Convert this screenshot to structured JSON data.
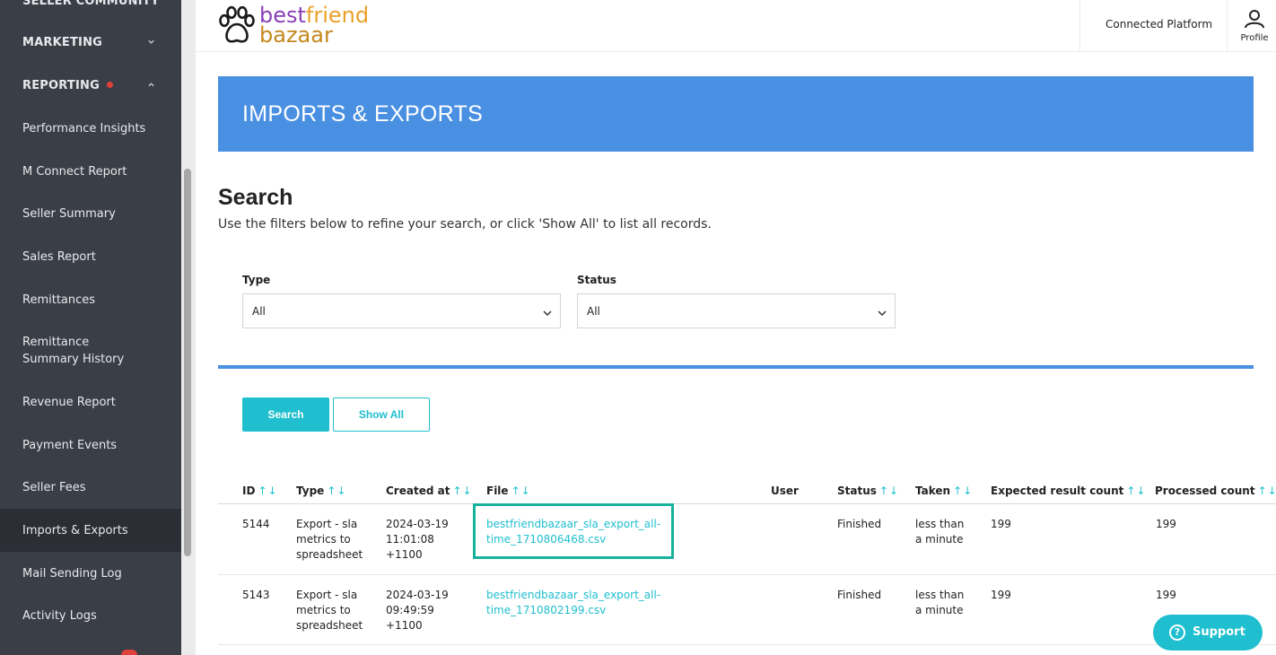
{
  "sidebar": {
    "sections": [
      {
        "label": "SELLER COMMUNITY"
      },
      {
        "label": "MARKETING"
      },
      {
        "label": "REPORTING"
      }
    ],
    "items": [
      {
        "label": "Performance Insights"
      },
      {
        "label": "M Connect Report"
      },
      {
        "label": "Seller Summary"
      },
      {
        "label": "Sales Report"
      },
      {
        "label": "Remittances"
      },
      {
        "label": "Remittance Summary History"
      },
      {
        "label": "Revenue Report"
      },
      {
        "label": "Payment Events"
      },
      {
        "label": "Seller Fees"
      },
      {
        "label": "Imports & Exports"
      },
      {
        "label": "Mail Sending Log"
      },
      {
        "label": "Activity Logs"
      }
    ],
    "active_item": "Imports & Exports"
  },
  "header": {
    "logo_line1_a": "best",
    "logo_line1_b": "friend",
    "logo_line2": "bazaar",
    "connected_platform": "Connected Platform",
    "profile_label": "Profile"
  },
  "banner": {
    "title": "IMPORTS & EXPORTS"
  },
  "search": {
    "title": "Search",
    "description": "Use the filters below to refine your search, or click 'Show All' to list all records.",
    "type_label": "Type",
    "type_value": "All",
    "status_label": "Status",
    "status_value": "All",
    "search_button": "Search",
    "show_all_button": "Show All"
  },
  "table": {
    "columns": [
      "ID",
      "Type",
      "Created at",
      "File",
      "User",
      "Status",
      "Taken",
      "Expected result count",
      "Processed count"
    ],
    "sort_arrows": "↑↓",
    "rows": [
      {
        "id": "5144",
        "type": [
          "Export - sla",
          "metrics to",
          "spreadsheet"
        ],
        "created": [
          "2024-03-19",
          "11:01:08",
          "+1100"
        ],
        "file": [
          "bestfriendbazaar_sla_export_all-",
          "time_1710806468.csv"
        ],
        "user": "",
        "status": "Finished",
        "taken": [
          "less than",
          "a minute"
        ],
        "expected": "199",
        "processed": "199"
      },
      {
        "id": "5143",
        "type": [
          "Export - sla",
          "metrics to",
          "spreadsheet"
        ],
        "created": [
          "2024-03-19",
          "09:49:59",
          "+1100"
        ],
        "file": [
          "bestfriendbazaar_sla_export_all-",
          "time_1710802199.csv"
        ],
        "user": "",
        "status": "Finished",
        "taken": [
          "less than",
          "a minute"
        ],
        "expected": "199",
        "processed": "199"
      }
    ]
  },
  "support": {
    "label": "Support"
  },
  "colors": {
    "sidebar_bg": "#3a3e47",
    "banner_blue": "#4a90e2",
    "accent_teal": "#1fbfcf",
    "highlight_green": "#17b29c",
    "alert_red": "#e0413a"
  }
}
